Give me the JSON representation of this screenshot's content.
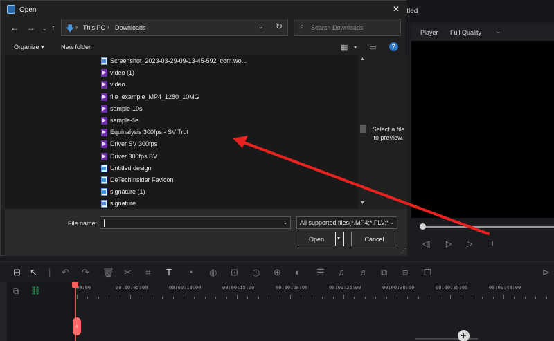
{
  "dialog": {
    "title": "Open",
    "close_icon": "close-icon",
    "address": {
      "crumbs": [
        "This PC",
        "Downloads"
      ]
    },
    "search": {
      "placeholder": "Search Downloads"
    },
    "commands": {
      "organize": "Organize ▾",
      "new_folder": "New folder"
    },
    "help_label": "?",
    "files": [
      {
        "name": "Screenshot_2023-03-29-09-13-45-592_com.wo...",
        "icon": "image-file-icon"
      },
      {
        "name": "video (1)",
        "icon": "video-file-icon"
      },
      {
        "name": "video",
        "icon": "video-file-icon"
      },
      {
        "name": "file_example_MP4_1280_10MG",
        "icon": "video-file-icon"
      },
      {
        "name": "sample-10s",
        "icon": "video-file-icon"
      },
      {
        "name": "sample-5s",
        "icon": "video-file-icon"
      },
      {
        "name": "Equinalysis 300fps - SV Trot",
        "icon": "video-file-icon"
      },
      {
        "name": "Driver SV 300fps",
        "icon": "video-file-icon"
      },
      {
        "name": "Driver 300fps BV",
        "icon": "video-file-icon"
      },
      {
        "name": "Untitled design",
        "icon": "image-file-icon"
      },
      {
        "name": "DeTechInsider Favicon",
        "icon": "image-file-icon"
      },
      {
        "name": "signature (1)",
        "icon": "image-file-icon"
      },
      {
        "name": "signature",
        "icon": "image-file-icon"
      }
    ],
    "preview_message": "Select a file to preview.",
    "file_name_label": "File name:",
    "file_name_value": "",
    "file_type_filter": "All supported files(*.MP4;*.FLV;*",
    "open_label": "Open",
    "cancel_label": "Cancel"
  },
  "editor": {
    "title_fragment": "itled",
    "player_label": "Player",
    "quality_label": "Full Quality",
    "timecodes": [
      "00:00",
      "00:00:05:00",
      "00:00:10:00",
      "00:00:15:00",
      "00:00:20:00",
      "00:00:25:00",
      "00:00:30:00",
      "00:00:35:00",
      "00:00:40:00"
    ]
  },
  "annotation": {
    "arrow_color": "#e8231f"
  }
}
